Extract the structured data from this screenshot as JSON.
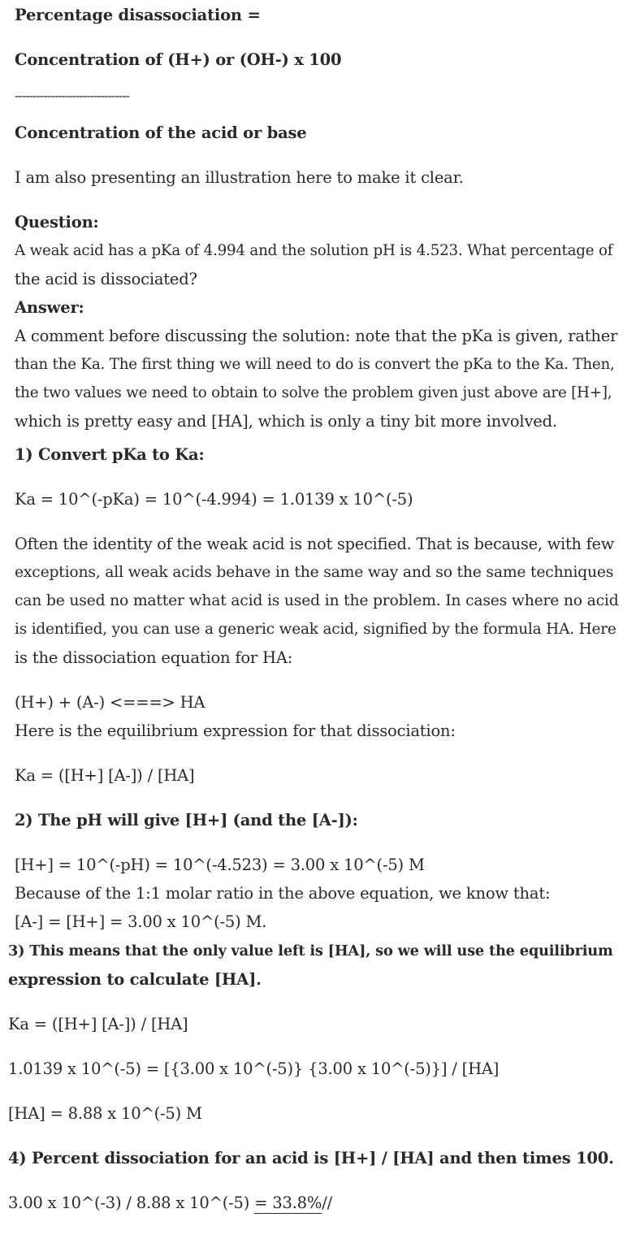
{
  "formula": {
    "title": "Percentage disassociation =",
    "numerator": "Concentration of (H+) or (OH-) x 100",
    "divider": "--------------------------------",
    "denominator": "Concentration of the acid or base"
  },
  "intro": "I am also presenting an illustration here to make it clear.",
  "question": {
    "label": "Question:",
    "line1": "A weak acid has a pKa of 4.994 and the solution pH is 4.523. What percentage of",
    "line2": "the acid is dissociated?"
  },
  "answer": {
    "label": "Answer:",
    "lines": [
      "A comment before discussing the solution: note that the pKa is given, rather",
      "than the Ka. The first thing we will need to do is convert the pKa to the Ka. Then,",
      "the two values we need to obtain to solve the problem given just above are [H+],",
      "which is pretty easy and [HA], which is only a tiny bit more involved."
    ]
  },
  "step1": {
    "heading": "1) Convert pKa to Ka:",
    "equation": "Ka = 10^(-pKa) = 10^(-4.994) = 1.0139 x 10^(-5)",
    "paragraph": [
      "Often the identity of the weak acid is not specified. That is because, with few",
      "exceptions, all weak acids behave in the same way and so the same techniques",
      "can be used no matter what acid is used in the problem. In cases where no acid",
      "is identified, you can use a generic weak acid, signified by the formula HA. Here",
      "is the dissociation equation for HA:"
    ],
    "dissociation": "(H+) + (A-) <===> HA",
    "expression_intro": "Here is the equilibrium expression for that dissociation:",
    "expression": "Ka = ([H+] [A-]) / [HA]"
  },
  "step2": {
    "heading": "2) The pH will give [H+] (and the [A-]):",
    "h_value": "[H+] = 10^(-pH) = 10^(-4.523) = 3.00 x 10^(-5) M",
    "ratio_text": "Because of the 1:1 molar ratio in the above equation, we know that:",
    "a_value": "[A-] = [H+] = 3.00 x 10^(-5) M."
  },
  "step3": {
    "heading_line1": "3) This means that the only value left is [HA], so we will use the equilibrium",
    "heading_line2": "expression to calculate [HA].",
    "expression": "Ka = ([H+] [A-]) / [HA]",
    "substitution": "1.0139 x 10^(-5) = [{3.00 x 10^(-5)} {3.00 x 10^(-5)}] / [HA]",
    "result": "[HA] = 8.88 x 10^(-5) M"
  },
  "step4": {
    "heading": "4) Percent dissociation for an acid is [H+] / [HA] and then times 100.",
    "calc_prefix": "3.00 x 10^(-3) / 8.88 x 10^(-5) ",
    "calc_result": "= 33.8%",
    "calc_suffix": "//"
  }
}
